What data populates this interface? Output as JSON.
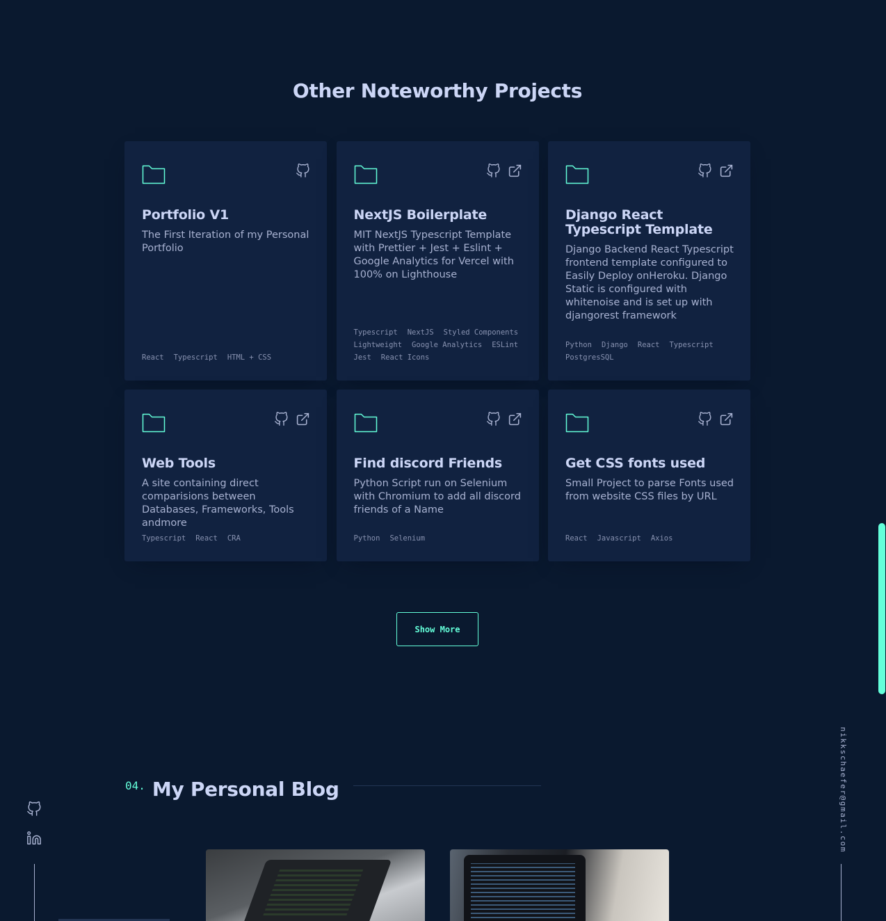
{
  "section": {
    "title": "Other Noteworthy Projects"
  },
  "projects": [
    {
      "title": "Portfolio V1",
      "description": "The First Iteration of my Personal Portfolio",
      "tags": [
        "React",
        "Typescript",
        "HTML + CSS"
      ],
      "links": [
        "github-icon"
      ]
    },
    {
      "title": "NextJS Boilerplate",
      "description": "MIT NextJS Typescript Template with Prettier + Jest + Eslint + Google Analytics for Vercel with 100% on Lighthouse",
      "tags": [
        "Typescript",
        "NextJS",
        "Styled Components",
        "Lightweight",
        "Google Analytics",
        "ESLint",
        "Jest",
        "React Icons"
      ],
      "links": [
        "github-icon",
        "external-link-icon"
      ]
    },
    {
      "title": "Django React Typescript Template",
      "description": "Django Backend React Typescript frontend template configured to Easily Deploy onHeroku. Django Static is configured with whitenoise and is set up with djangorest framework",
      "tags": [
        "Python",
        "Django",
        "React",
        "Typescript",
        "PostgresSQL"
      ],
      "links": [
        "github-icon",
        "external-link-icon"
      ]
    },
    {
      "title": "Web Tools",
      "description": "A site containing direct comparisions between Databases, Frameworks, Tools andmore",
      "tags": [
        "Typescript",
        "React",
        "CRA"
      ],
      "links": [
        "github-icon",
        "external-link-icon"
      ]
    },
    {
      "title": "Find discord Friends",
      "description": "Python Script run on Selenium with Chromium to add all discord friends of a Name",
      "tags": [
        "Python",
        "Selenium"
      ],
      "links": [
        "github-icon",
        "external-link-icon"
      ]
    },
    {
      "title": "Get CSS fonts used",
      "description": "Small Project to parse Fonts used from website CSS files by URL",
      "tags": [
        "React",
        "Javascript",
        "Axios"
      ],
      "links": [
        "github-icon",
        "external-link-icon"
      ]
    }
  ],
  "show_more": {
    "label": "Show More"
  },
  "blog": {
    "number": "04.",
    "title": "My Personal Blog"
  },
  "sidebar": {
    "social": [
      "github-icon",
      "linkedin-icon"
    ],
    "email": "nikkschaefer@gmail.com"
  },
  "colors": {
    "background": "#0a192f",
    "card": "#112240",
    "accent": "#64ffda",
    "heading": "#ccd6f6",
    "text": "#a8b2d1",
    "muted": "#8892b0"
  }
}
